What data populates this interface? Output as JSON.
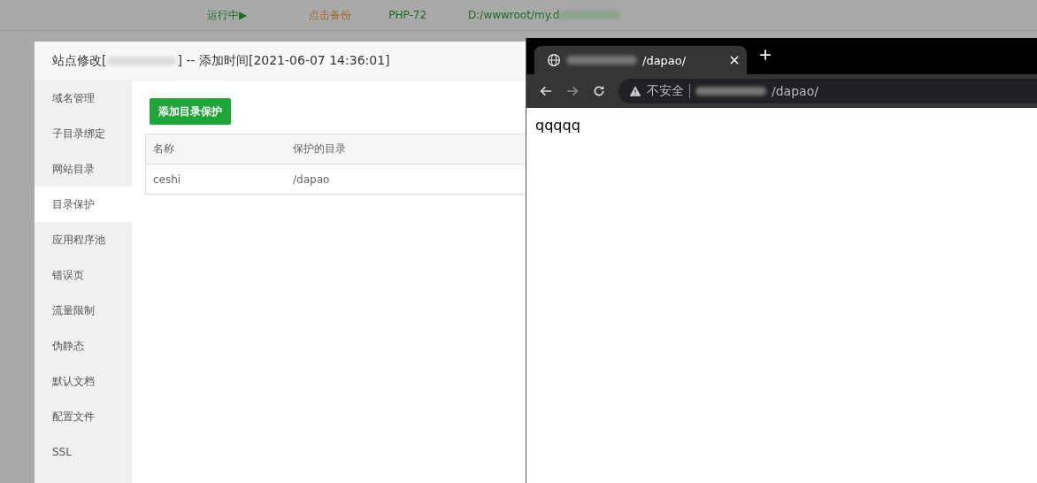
{
  "background_bar": {
    "status": "运行中▶",
    "backup": "点击备份",
    "php": "PHP-72",
    "path": "D:/wwwroot/my.d"
  },
  "dialog": {
    "title_start": "站点修改[",
    "title_end": "] -- 添加时间[2021-06-07 14:36:01]",
    "sidebar": [
      {
        "label": "域名管理",
        "selected": false
      },
      {
        "label": "子目录绑定",
        "selected": false
      },
      {
        "label": "网站目录",
        "selected": false
      },
      {
        "label": "目录保护",
        "selected": true
      },
      {
        "label": "应用程序池",
        "selected": false
      },
      {
        "label": "错误页",
        "selected": false
      },
      {
        "label": "流量限制",
        "selected": false
      },
      {
        "label": "伪静态",
        "selected": false
      },
      {
        "label": "默认文档",
        "selected": false
      },
      {
        "label": "配置文件",
        "selected": false
      },
      {
        "label": "SSL",
        "selected": false
      }
    ],
    "add_button": "添加目录保护",
    "table": {
      "columns": [
        "名称",
        "保护的目录"
      ],
      "rows": [
        [
          "ceshi",
          "/dapao"
        ]
      ]
    }
  },
  "browser": {
    "tab_title": "/dapao/",
    "security": "不安全",
    "url": "/dapao/",
    "page_text": "qqqqq"
  }
}
